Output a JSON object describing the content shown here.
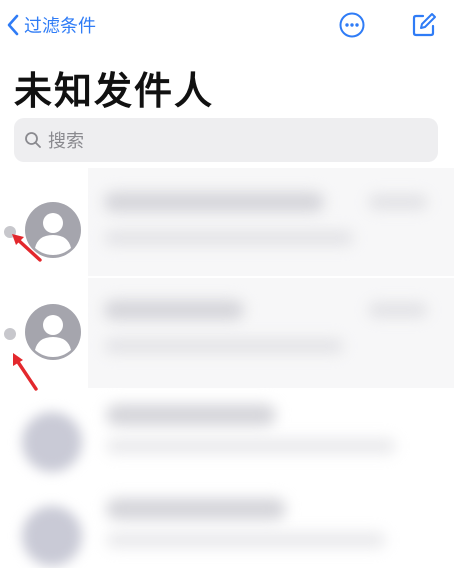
{
  "nav": {
    "back_label": "过滤条件",
    "back_icon": "chevron-left-icon",
    "more_icon": "ellipsis-circle-icon",
    "compose_icon": "compose-icon"
  },
  "page": {
    "title": "未知发件人"
  },
  "search": {
    "placeholder": "搜索",
    "icon": "magnifier-icon"
  },
  "colors": {
    "accent": "#2f7cf6",
    "arrow": "#e3282d",
    "avatar": "#a5a5ad"
  },
  "messages": [
    {
      "unread": true,
      "annotated": true
    },
    {
      "unread": true,
      "annotated": true
    },
    {
      "unread": false,
      "annotated": false
    },
    {
      "unread": false,
      "annotated": false
    }
  ]
}
